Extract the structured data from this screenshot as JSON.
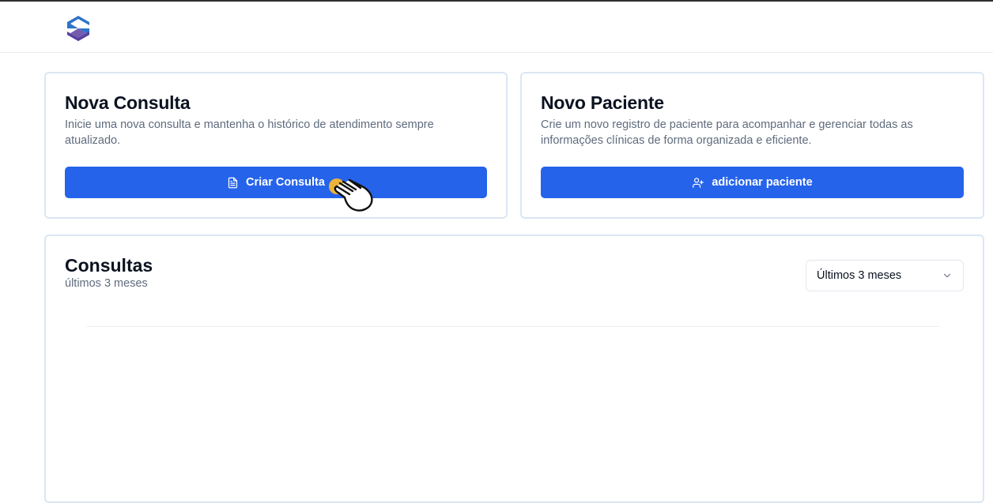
{
  "header": {
    "logo_icon": "logo-s-hexagon-icon",
    "brand_colors": [
      "#2e73c7",
      "#5b3fa0"
    ]
  },
  "new_consultation": {
    "title": "Nova Consulta",
    "description": "Inicie uma nova consulta e mantenha o histórico de atendimento sempre atualizado.",
    "button_label": "Criar Consulta",
    "button_icon": "file-text-icon"
  },
  "new_patient": {
    "title": "Novo Paciente",
    "description": "Crie um novo registro de paciente para acompanhar e gerenciar todas as informações clínicas de forma organizada e eficiente.",
    "button_label": "adicionar paciente",
    "button_icon": "user-plus-icon"
  },
  "consultations": {
    "title": "Consultas",
    "subtitle": "últimos 3 meses",
    "range_select": {
      "value": "Últimos 3 meses",
      "icon": "chevron-down-icon"
    }
  },
  "colors": {
    "primary": "#2563eb",
    "card_border": "#dbe6f3",
    "muted_text": "#5f6b7d",
    "cursor_highlight": "#f5b82e"
  }
}
